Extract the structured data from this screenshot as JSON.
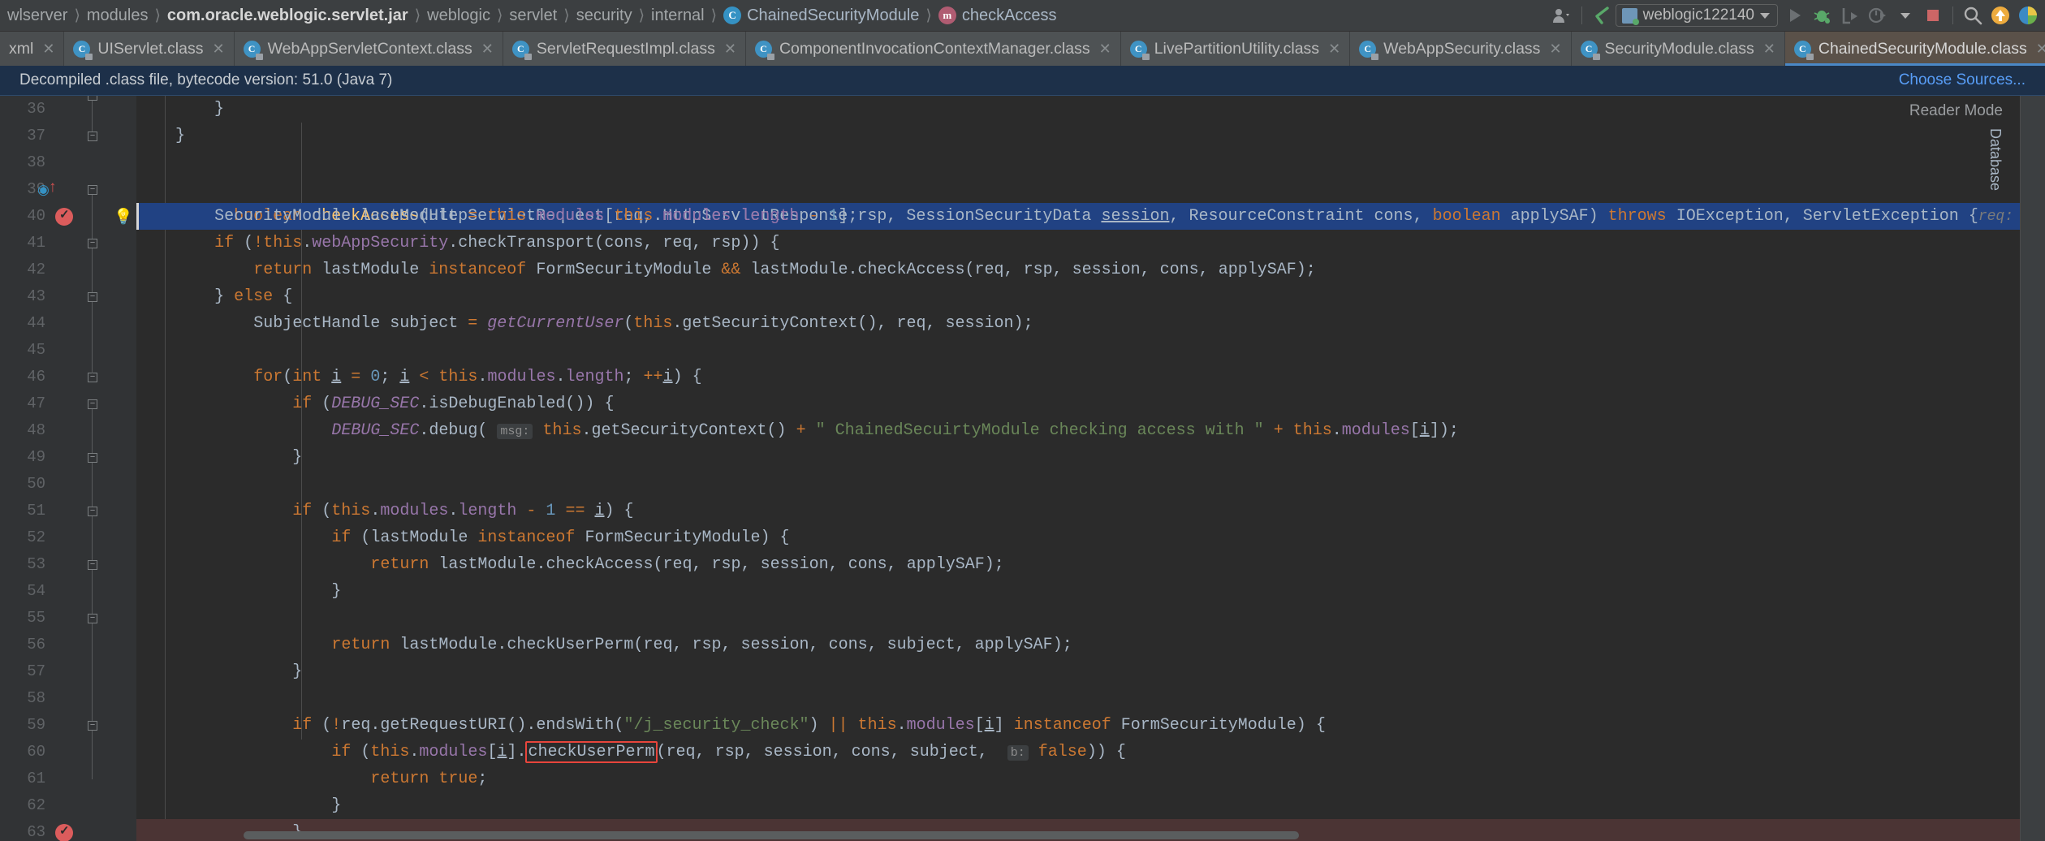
{
  "navbar": {
    "breadcrumbs": [
      {
        "label": "wlserver",
        "icon": null,
        "style": "dim"
      },
      {
        "label": "modules",
        "icon": null,
        "style": "dim"
      },
      {
        "label": "com.oracle.weblogic.servlet.jar",
        "icon": null,
        "style": "bold"
      },
      {
        "label": "weblogic",
        "icon": null,
        "style": "dim"
      },
      {
        "label": "servlet",
        "icon": null,
        "style": "dim"
      },
      {
        "label": "security",
        "icon": null,
        "style": "dim"
      },
      {
        "label": "internal",
        "icon": null,
        "style": "dim"
      },
      {
        "label": "ChainedSecurityModule",
        "icon": "class-icon",
        "style": "normal"
      },
      {
        "label": "checkAccess",
        "icon": "method-icon",
        "style": "normal"
      }
    ],
    "run_configuration": "weblogic122140",
    "toolbar_icons": [
      "user-avatar-icon",
      "vcs-update-icon",
      "run-icon",
      "debug-icon",
      "run-with-coverage-icon",
      "profile-icon",
      "stop-icon",
      "search-everywhere-icon",
      "update-project-icon",
      "settings-icon"
    ]
  },
  "tabs": {
    "first_partial_label": "xml",
    "items": [
      {
        "label": "UIServlet.class",
        "active": false
      },
      {
        "label": "WebAppServletContext.class",
        "active": false
      },
      {
        "label": "ServletRequestImpl.class",
        "active": false
      },
      {
        "label": "ComponentInvocationContextManager.class",
        "active": false
      },
      {
        "label": "LivePartitionUtility.class",
        "active": false
      },
      {
        "label": "WebAppSecurity.class",
        "active": false
      },
      {
        "label": "SecurityModule.class",
        "active": false
      },
      {
        "label": "ChainedSecurityModule.class",
        "active": true
      }
    ],
    "overflow_icon": "chevron-down-icon"
  },
  "notification": {
    "message": "Decompiled .class file, bytecode version: 51.0 (Java 7)",
    "action_label": "Choose Sources...",
    "background": "#1d3049",
    "link_color": "#589df6"
  },
  "editor": {
    "reader_mode_label": "Reader Mode",
    "side_tool_label": "Database",
    "inline_hint_signature": "req: \"weblogi",
    "selected_line": 40,
    "breakpoint_lines": [
      40,
      60
    ],
    "error_highlight": "checkUserPerm",
    "lines": [
      {
        "num": 36,
        "indent": 0
      },
      {
        "num": 37,
        "indent": 0
      },
      {
        "num": 38,
        "indent": 0
      },
      {
        "num": 39,
        "indent": 0
      },
      {
        "num": 40,
        "indent": 0
      },
      {
        "num": 41,
        "indent": 0
      },
      {
        "num": 42,
        "indent": 0
      },
      {
        "num": 43,
        "indent": 0
      },
      {
        "num": 44,
        "indent": 0
      },
      {
        "num": 45,
        "indent": 0
      },
      {
        "num": 46,
        "indent": 0
      },
      {
        "num": 47,
        "indent": 0
      },
      {
        "num": 48,
        "indent": 0
      },
      {
        "num": 49,
        "indent": 0
      },
      {
        "num": 50,
        "indent": 0
      },
      {
        "num": 51,
        "indent": 0
      },
      {
        "num": 52,
        "indent": 0
      },
      {
        "num": 53,
        "indent": 0
      },
      {
        "num": 54,
        "indent": 0
      },
      {
        "num": 55,
        "indent": 0
      },
      {
        "num": 56,
        "indent": 0
      },
      {
        "num": 57,
        "indent": 0
      },
      {
        "num": 58,
        "indent": 0
      },
      {
        "num": 59,
        "indent": 0
      },
      {
        "num": 60,
        "indent": 0
      },
      {
        "num": 61,
        "indent": 0
      },
      {
        "num": 62,
        "indent": 0
      },
      {
        "num": 63,
        "indent": 0
      }
    ],
    "code_text": [
      "        }",
      "    }",
      "",
      "    boolean checkAccess(HttpServletRequest req, HttpServletResponse rsp, SessionSecurityData session, ResourceConstraint cons, boolean applySAF) throws IOException, ServletException {",
      "        SecurityModule lastModule = this.modules[this.modules.length - 1];",
      "        if (!this.webAppSecurity.checkTransport(cons, req, rsp)) {",
      "            return lastModule instanceof FormSecurityModule && lastModule.checkAccess(req, rsp, session, cons, applySAF);",
      "        } else {",
      "            SubjectHandle subject = getCurrentUser(this.getSecurityContext(), req, session);",
      "",
      "            for(int i = 0; i < this.modules.length; ++i) {",
      "                if (DEBUG_SEC.isDebugEnabled()) {",
      "                    DEBUG_SEC.debug( msg: this.getSecurityContext() + \" ChainedSecuirtyModule checking access with \" + this.modules[i]);",
      "                }",
      "",
      "                if (this.modules.length - 1 == i) {",
      "                    if (lastModule instanceof FormSecurityModule) {",
      "                        return lastModule.checkAccess(req, rsp, session, cons, applySAF);",
      "                    }",
      "",
      "                    return lastModule.checkUserPerm(req, rsp, session, cons, subject, applySAF);",
      "                }",
      "",
      "                if (!req.getRequestURI().endsWith(\"/j_security_check\") || this.modules[i] instanceof FormSecurityModule) {",
      "                    if (this.modules[i].checkUserPerm(req, rsp, session, cons, subject,  b: false)) {",
      "                        return true;",
      "                    }",
      "                }",
      ""
    ]
  },
  "colors": {
    "editor_bg": "#2b2b2b",
    "gutter_bg": "#313335",
    "chrome_bg": "#3c3f41",
    "selection": "#214283",
    "breakpoint_line": "#4b3434",
    "keyword": "#cc7832",
    "method": "#ffc66d",
    "field": "#9876aa",
    "string": "#6a8759",
    "number": "#6897bb",
    "default_text": "#a9b7c6",
    "active_tab": "#5a5149",
    "tab_underline": "#4a88c7"
  }
}
